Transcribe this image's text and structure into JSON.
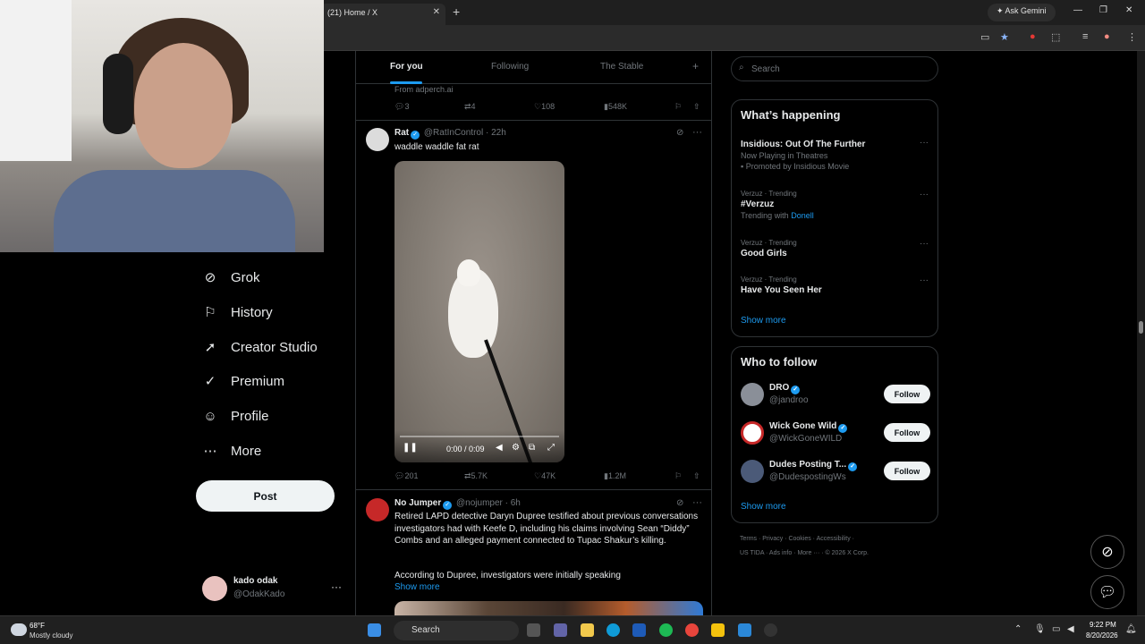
{
  "browser": {
    "tab_title": "(21) Home / X",
    "ask_gemini": "Ask Gemini",
    "new_tab": "+",
    "tab_close": "✕"
  },
  "nav": {
    "items": [
      {
        "label": "Grok",
        "icon": "grok-icon"
      },
      {
        "label": "History",
        "icon": "bookmark-icon"
      },
      {
        "label": "Creator Studio",
        "icon": "rocket-icon"
      },
      {
        "label": "Premium",
        "icon": "verified-icon"
      },
      {
        "label": "Profile",
        "icon": "person-icon"
      },
      {
        "label": "More",
        "icon": "more-circle-icon"
      }
    ],
    "post_label": "Post",
    "account": {
      "name": "kado odak",
      "handle": "@OdakKado"
    }
  },
  "feed": {
    "tabs": [
      "For you",
      "Following",
      "The Stable"
    ],
    "add_tab": "+",
    "prev_tweet": {
      "source": "From adperch.ai",
      "replies": "3",
      "reposts": "4",
      "likes": "108",
      "views": "548K"
    },
    "tweet1": {
      "name": "Rat",
      "handle": "@RatInControl",
      "time": "· 22h",
      "text": "waddle waddle fat rat",
      "video_time": "0:00 / 0:09",
      "replies": "201",
      "reposts": "5.7K",
      "likes": "47K",
      "views": "1.2M"
    },
    "tweet2": {
      "name": "No Jumper",
      "handle": "@nojumper",
      "time": "· 6h",
      "text": "Retired LAPD detective Daryn Dupree testified about previous conversations investigators had with Keefe D, including his claims involving Sean “Diddy” Combs and an alleged payment connected to Tupac Shakur’s killing.",
      "text2": "According to Dupree, investigators were initially speaking",
      "show_more": "Show more"
    }
  },
  "sidebar": {
    "search_placeholder": "Search",
    "happening_title": "What’s happening",
    "trends": [
      {
        "category": "",
        "name": "Insidious: Out Of The Further",
        "sub": "Now Playing in Theatres",
        "promo": "Promoted by Insidious Movie"
      },
      {
        "category": "Verzuz · Trending",
        "name": "#Verzuz",
        "sub": "Trending with",
        "sub_link": "Donell"
      },
      {
        "category": "Verzuz · Trending",
        "name": "Good Girls"
      },
      {
        "category": "Verzuz · Trending",
        "name": "Have You Seen Her"
      }
    ],
    "show_more": "Show more",
    "wtf_title": "Who to follow",
    "who_to_follow": [
      {
        "name": "DRO",
        "handle": "@jandroo"
      },
      {
        "name": "Wick Gone Wild",
        "handle": "@WickGoneWILD"
      },
      {
        "name": "Dudes Posting T...",
        "handle": "@DudespostingWs"
      }
    ],
    "follow_label": "Follow",
    "footer_line1": "Terms · Privacy · Cookies · Accessibility ·",
    "footer_line2": "US TIDA · Ads info · More ··· · © 2026 X Corp."
  },
  "taskbar": {
    "temp": "68°F",
    "weather": "Mostly cloudy",
    "search": "Search",
    "time": "9:22 PM",
    "date": "8/20/2026"
  },
  "colors": {
    "accent": "#1d9bf0",
    "background": "#000000"
  }
}
